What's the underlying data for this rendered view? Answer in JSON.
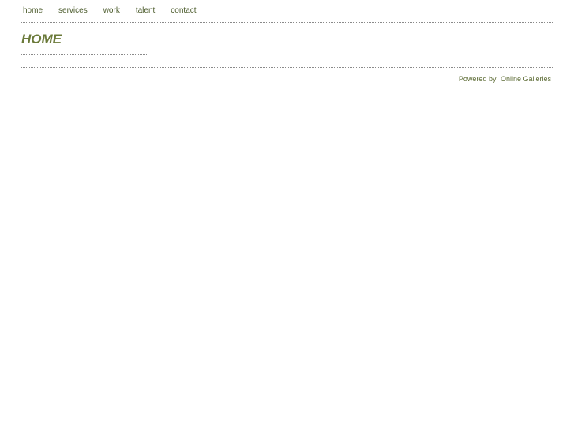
{
  "nav": {
    "items": [
      {
        "label": "home"
      },
      {
        "label": "services"
      },
      {
        "label": "work"
      },
      {
        "label": "talent"
      },
      {
        "label": "contact"
      }
    ]
  },
  "main": {
    "title": "HOME"
  },
  "footer": {
    "powered_by": "Powered by",
    "link_label": "Online Galleries"
  },
  "colors": {
    "accent": "#6b7a3a",
    "nav_text": "#4a5a2a",
    "rule": "#8a8a8a",
    "background": "#ffffff"
  }
}
